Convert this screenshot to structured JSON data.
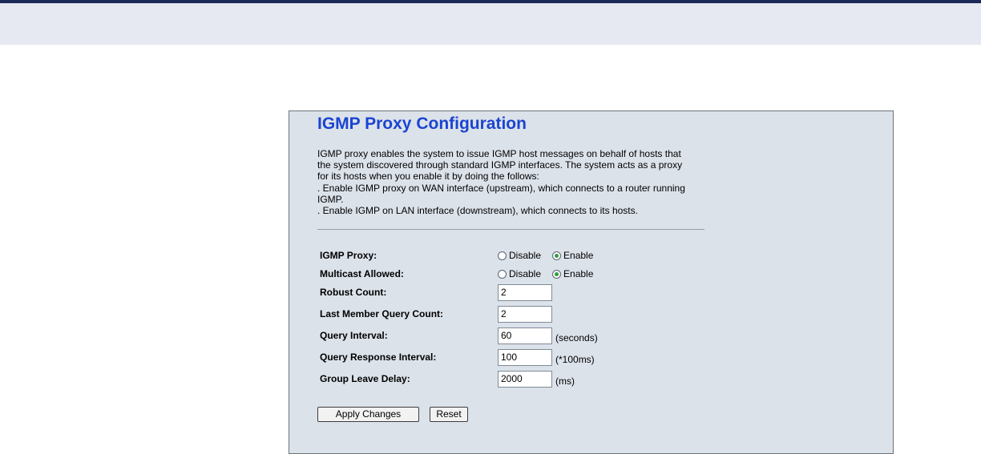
{
  "page": {
    "title": "IGMP Proxy Configuration",
    "description": [
      "IGMP proxy enables the system to issue IGMP host messages on behalf of hosts that",
      "the system discovered through standard IGMP interfaces. The system acts as a proxy",
      "for its hosts when you enable it by doing the follows:",
      ". Enable IGMP proxy on WAN interface (upstream), which connects to a router running",
      "IGMP.",
      ". Enable IGMP on LAN interface (downstream), which connects to its hosts."
    ]
  },
  "form": {
    "igmp_proxy": {
      "label": "IGMP Proxy:",
      "options": [
        "Disable",
        "Enable"
      ],
      "selected": "Enable"
    },
    "multicast_allowed": {
      "label": "Multicast Allowed:",
      "options": [
        "Disable",
        "Enable"
      ],
      "selected": "Enable"
    },
    "robust_count": {
      "label": "Robust Count:",
      "value": "2",
      "unit": ""
    },
    "last_member_query_count": {
      "label": "Last Member Query Count:",
      "value": "2",
      "unit": ""
    },
    "query_interval": {
      "label": "Query Interval:",
      "value": "60",
      "unit": "(seconds)"
    },
    "query_response_interval": {
      "label": "Query Response Interval:",
      "value": "100",
      "unit": "(*100ms)"
    },
    "group_leave_delay": {
      "label": "Group Leave Delay:",
      "value": "2000",
      "unit": "(ms)"
    }
  },
  "buttons": {
    "apply": "Apply Changes",
    "reset": "Reset"
  },
  "colors": {
    "title": "#1a44d1",
    "panel_bg": "#dce2ea",
    "top_band": "#e6e9f2",
    "top_rule": "#1b2a57",
    "radio_selected": "#2f9e3e"
  }
}
